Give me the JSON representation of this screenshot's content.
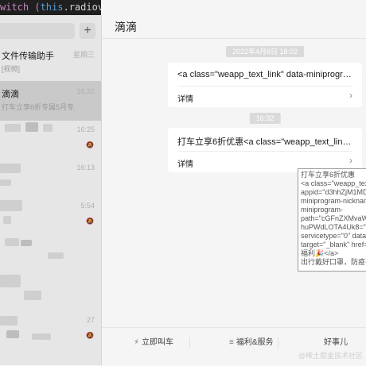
{
  "code": {
    "prefix": "witch (",
    "this_kw": "this",
    "suffix": ".radiovalue){"
  },
  "sidebar": {
    "add_symbol": "+",
    "chats": [
      {
        "name": "文件传输助手",
        "preview": "[视频]",
        "time": "星期三"
      },
      {
        "name": "滴滴",
        "preview": "打车立享6折专属5月专属...",
        "time": "16:32"
      },
      {
        "time": "16:25"
      },
      {
        "time": "16:13"
      },
      {
        "time": "5:54"
      },
      {
        "time": ""
      },
      {
        "time": ""
      },
      {
        "time": "27"
      }
    ]
  },
  "chat": {
    "title": "滴滴",
    "timestamps": [
      "2022年4月8日 18:02",
      "16:32"
    ],
    "cards": [
      {
        "text": "<a class=\"weapp_text_link\" data-miniprogram-appid=\"d3hhZjM1MDc5OGYwNDc1MjI4NDQ\"",
        "footer": "详情"
      },
      {
        "text": "打车立享6折优惠<a class=\"weapp_text_link\" data-miniprogram-appid",
        "footer": "详情"
      }
    ],
    "tooltip_lines": [
      "打车立享6折优惠",
      "<a class=\"weapp_tex",
      "appid=\"d3hhZjM1MD",
      "miniprogram-nicknam",
      "miniprogram-",
      "path=\"cGFnZXMvaW5",
      "huPWdLOTA4Uk8=\" d",
      "servicetype=\"0\" data-",
      "target=\"_blank\" href=",
      "福利🎉</a>",
      "出行戴好口罩，防疫不"
    ],
    "menu": [
      {
        "icon": "⚡",
        "label": "立即叫车"
      },
      {
        "icon": "≡",
        "label": "福利&服务"
      },
      {
        "icon": "",
        "label": "好事儿"
      }
    ]
  },
  "watermark": "@稀土掘金技术社区"
}
